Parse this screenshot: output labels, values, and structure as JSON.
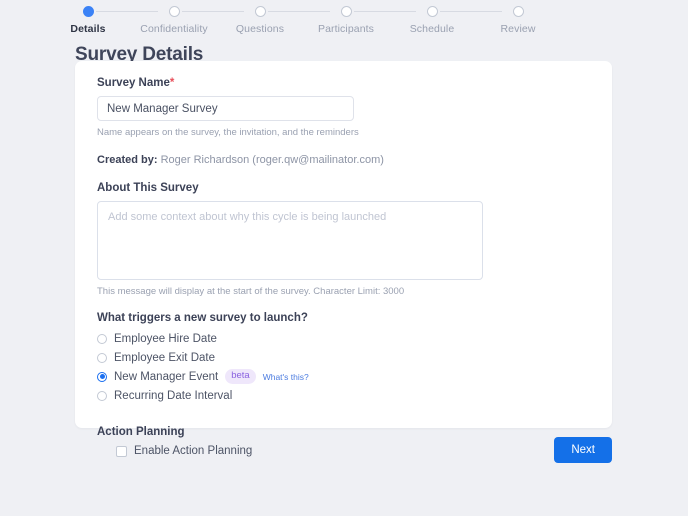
{
  "stepper": {
    "steps": [
      {
        "label": "Details",
        "state": "active"
      },
      {
        "label": "Confidentiality",
        "state": "inactive"
      },
      {
        "label": "Questions",
        "state": "inactive"
      },
      {
        "label": "Participants",
        "state": "inactive"
      },
      {
        "label": "Schedule",
        "state": "inactive"
      },
      {
        "label": "Review",
        "state": "inactive"
      }
    ]
  },
  "page": {
    "title": "Survey Details"
  },
  "form": {
    "survey_name": {
      "label": "Survey Name",
      "required_marker": "*",
      "value": "New Manager Survey",
      "placeholder": "Survey Name",
      "helper": "Name appears on the survey, the invitation, and the reminders"
    },
    "created_by": {
      "label": "Created by:",
      "value": "Roger Richardson (roger.qw@mailinator.com)"
    },
    "about": {
      "label": "About This Survey",
      "value": "",
      "placeholder": "Add some context about why this cycle is being launched",
      "helper": "This message will display at the start of the survey. Character Limit: 3000"
    },
    "trigger": {
      "question": "What triggers a new survey to launch?",
      "options": [
        {
          "label": "Employee Hire Date",
          "selected": false
        },
        {
          "label": "Employee Exit Date",
          "selected": false
        },
        {
          "label": "New Manager Event",
          "selected": true,
          "badge": "beta",
          "link": "What's this?"
        },
        {
          "label": "Recurring Date Interval",
          "selected": false
        }
      ]
    },
    "action_planning": {
      "heading": "Action Planning",
      "checkbox_label": "Enable Action Planning",
      "checked": false
    }
  },
  "footer": {
    "next_label": "Next"
  },
  "colors": {
    "page_background": "#eff0f4",
    "card_background": "#ffffff",
    "accent_blue": "#1470e8",
    "step_active": "#3b82f6",
    "required_red": "#e8505b",
    "badge_text": "#8b63e0",
    "badge_background": "#efe7fb",
    "link_blue": "#4c7ce0"
  }
}
